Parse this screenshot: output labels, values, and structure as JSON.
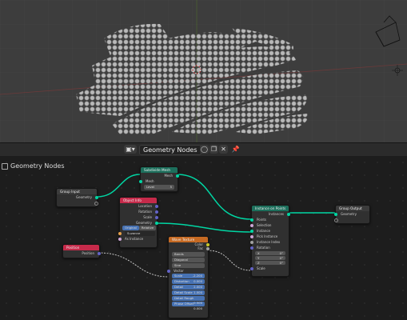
{
  "header": {
    "tree_name": "Geometry Nodes",
    "editor_icon": "node-editor-icon"
  },
  "breadcrumb": "Geometry Nodes",
  "nodes": {
    "group_input": {
      "title": "Group Input",
      "geometry": "Geometry"
    },
    "subdivide": {
      "title": "Subdivide Mesh",
      "mesh_out": "Mesh",
      "mesh_in": "Mesh",
      "level_label": "Level",
      "level_value": "5"
    },
    "object_info": {
      "title": "Object Info",
      "location": "Location",
      "rotation": "Rotation",
      "scale": "Scale",
      "geometry": "Geometry",
      "original": "Original",
      "relative": "Relative",
      "object": "Suzanne",
      "as_instance": "As Instance"
    },
    "position": {
      "title": "Position",
      "position": "Position"
    },
    "wave": {
      "title": "Wave Texture",
      "color": "Color",
      "fac": "Fac",
      "bands": "Bands",
      "diagonal": "Diagonal",
      "sine": "Sine",
      "vector": "Vector",
      "fields": [
        {
          "label": "Scale",
          "value": "-2.200"
        },
        {
          "label": "Distortion",
          "value": "0.000"
        },
        {
          "label": "Detail",
          "value": "2.000"
        },
        {
          "label": "Detail Scale",
          "value": "1.000"
        },
        {
          "label": "Detail Rough",
          "value": "0.500"
        },
        {
          "label": "Phase Offset",
          "value": "0.000"
        }
      ]
    },
    "instance_on_points": {
      "title": "Instance on Points",
      "instances": "Instances",
      "points": "Points",
      "selection": "Selection",
      "instance": "Instance",
      "pick_instance": "Pick Instance",
      "instance_index": "Instance Index",
      "rotation": "Rotation",
      "x": "X",
      "x_val": "0°",
      "y": "Y",
      "y_val": "0°",
      "z": "Z",
      "z_val": "0°",
      "scale": "Scale"
    },
    "group_output": {
      "title": "Group Output",
      "geometry": "Geometry"
    }
  },
  "colors": {
    "geometry_socket": "#00d6a3",
    "vector_socket": "#6363c7",
    "float_socket": "#a1a1a1",
    "color_socket": "#c7c729",
    "input_header": "#3c1d26",
    "geometry_header": "#1d6f5c",
    "texture_header": "#c66a23",
    "output_header": "#3c1d26"
  }
}
